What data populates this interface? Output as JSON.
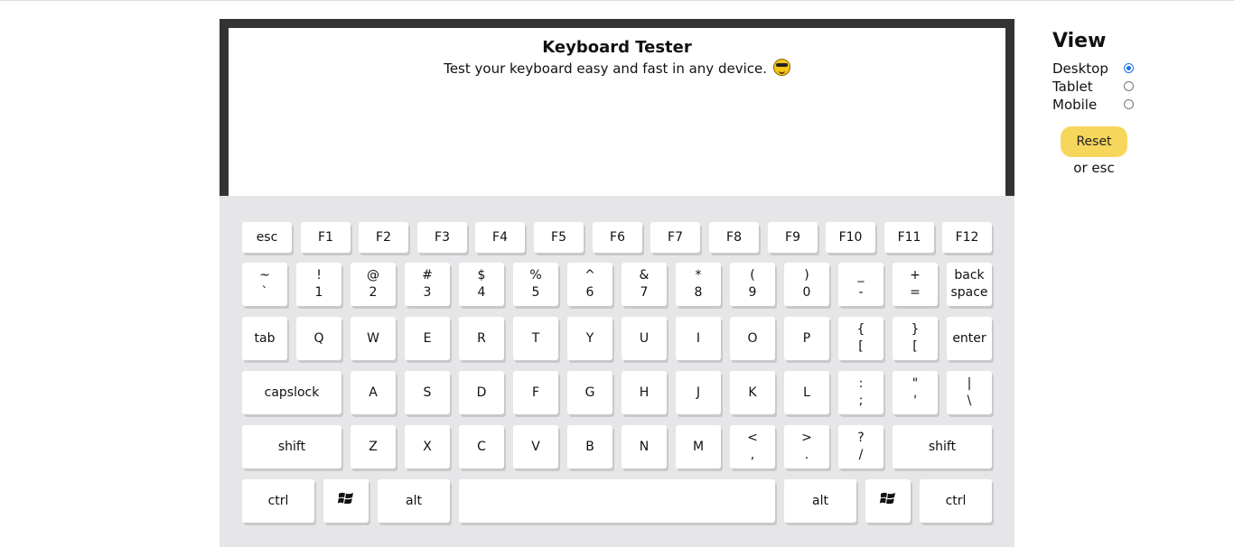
{
  "header": {
    "title": "Keyboard Tester",
    "subtitle": "Test your keyboard easy and fast in any device."
  },
  "view_panel": {
    "heading": "View",
    "options": [
      {
        "label": "Desktop",
        "selected": true
      },
      {
        "label": "Tablet",
        "selected": false
      },
      {
        "label": "Mobile",
        "selected": false
      }
    ],
    "reset_label": "Reset",
    "reset_hint": "or esc"
  },
  "keyboard": {
    "row_fn": [
      "esc",
      "F1",
      "F2",
      "F3",
      "F4",
      "F5",
      "F6",
      "F7",
      "F8",
      "F9",
      "F10",
      "F11",
      "F12"
    ],
    "row_num": [
      {
        "top": "~",
        "bottom": "`"
      },
      {
        "top": "!",
        "bottom": "1"
      },
      {
        "top": "@",
        "bottom": "2"
      },
      {
        "top": "#",
        "bottom": "3"
      },
      {
        "top": "$",
        "bottom": "4"
      },
      {
        "top": "%",
        "bottom": "5"
      },
      {
        "top": "^",
        "bottom": "6"
      },
      {
        "top": "&",
        "bottom": "7"
      },
      {
        "top": "*",
        "bottom": "8"
      },
      {
        "top": "(",
        "bottom": "9"
      },
      {
        "top": ")",
        "bottom": "0"
      },
      {
        "top": "_",
        "bottom": "-"
      },
      {
        "top": "+",
        "bottom": "="
      },
      {
        "top": "back",
        "bottom": "space"
      }
    ],
    "row_q": [
      {
        "top": "tab"
      },
      {
        "top": "Q"
      },
      {
        "top": "W"
      },
      {
        "top": "E"
      },
      {
        "top": "R"
      },
      {
        "top": "T"
      },
      {
        "top": "Y"
      },
      {
        "top": "U"
      },
      {
        "top": "I"
      },
      {
        "top": "O"
      },
      {
        "top": "P"
      },
      {
        "top": "{",
        "bottom": "["
      },
      {
        "top": "}",
        "bottom": "["
      },
      {
        "top": "enter"
      }
    ],
    "row_a": [
      {
        "top": "capslock"
      },
      {
        "top": "A"
      },
      {
        "top": "S"
      },
      {
        "top": "D"
      },
      {
        "top": "F"
      },
      {
        "top": "G"
      },
      {
        "top": "H"
      },
      {
        "top": "J"
      },
      {
        "top": "K"
      },
      {
        "top": "L"
      },
      {
        "top": ":",
        "bottom": ";"
      },
      {
        "top": "\"",
        "bottom": "'"
      },
      {
        "top": "|",
        "bottom": "\\"
      }
    ],
    "row_z": [
      {
        "top": "shift"
      },
      {
        "top": "Z"
      },
      {
        "top": "X"
      },
      {
        "top": "C"
      },
      {
        "top": "V"
      },
      {
        "top": "B"
      },
      {
        "top": "N"
      },
      {
        "top": "M"
      },
      {
        "top": "<",
        "bottom": ","
      },
      {
        "top": ">",
        "bottom": "."
      },
      {
        "top": "?",
        "bottom": "/"
      },
      {
        "top": "shift"
      }
    ],
    "row_bottom": [
      {
        "top": "ctrl"
      },
      {
        "icon": "windows-icon"
      },
      {
        "top": "alt"
      },
      {
        "top": ""
      },
      {
        "top": "alt"
      },
      {
        "icon": "windows-icon"
      },
      {
        "top": "ctrl"
      }
    ]
  },
  "colors": {
    "reset_button": "#f7d65c",
    "keyboard_bg": "#e6e6e8",
    "bezel": "#333333",
    "radio_selected": "#1a73e8"
  }
}
